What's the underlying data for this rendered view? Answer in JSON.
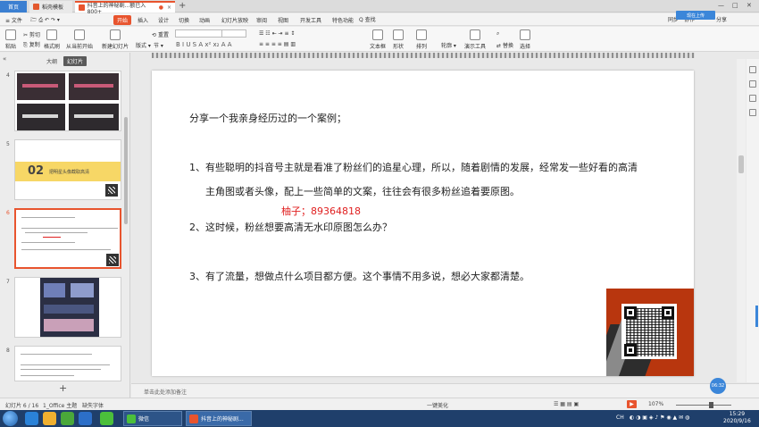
{
  "titlebar": {
    "tab_home": "首页",
    "tab_template": "稻壳模板",
    "tab_doc": "抖音上的神秘剧...额已入800+",
    "new_tab": "+"
  },
  "menubar": {
    "file": "≡ 文件",
    "items": [
      "开始",
      "插入",
      "设计",
      "切换",
      "动画",
      "幻灯片放映",
      "审阅",
      "视图",
      "开发工具",
      "特色功能"
    ],
    "search": "Q 查找",
    "sync": "同步",
    "coop": "协作",
    "share": "分享",
    "sync_upload": "现在上传"
  },
  "ribbon": {
    "paste": "粘贴",
    "cut": "剪切",
    "copy": "复制",
    "format_painter": "格式刷",
    "from_current": "从当前开始",
    "new_slide": "新建幻灯片",
    "layout": "版式",
    "section": "节",
    "reset": "重置",
    "textbox": "文本框",
    "shape": "形状",
    "arrange": "排列",
    "outline": "轮廓",
    "present_tools": "演示工具",
    "replace": "替换",
    "select": "选择",
    "format_glyphs": "B I U S A x² x₂ A A"
  },
  "left_panel": {
    "tab_outline": "大纲",
    "tab_slides": "幻灯片",
    "slide_numbers": [
      "4",
      "5",
      "6",
      "7",
      "8"
    ],
    "thumb5_num": "02",
    "thumb5_title": "把明星头像截取高清",
    "add": "+"
  },
  "slide": {
    "line_intro": "分享一个我亲身经历过的一个案例；",
    "line1a": "1、有些聪明的抖音号主就是看准了粉丝们的追星心理，所以，随着剧情的发展，经常发一些好看的高清",
    "line1b": "主角图或者头像，配上一些简单的文案，往往会有很多粉丝追着要原图。",
    "red_note": "柚子；89364818",
    "line2": "2、这时候，粉丝想要高清无水印原图怎么办？",
    "line3": "3、有了流量，想做点什么项目都方便。这个事情不用多说，想必大家都清楚。"
  },
  "notes": {
    "placeholder": "单击此处添加备注"
  },
  "statusbar": {
    "slide_info": "幻灯片 6 / 16",
    "theme": "1_Office 主题",
    "font_missing": "缺失字体",
    "beautify": "一键美化",
    "zoom": "107%",
    "bubble": "06:32"
  },
  "taskbar": {
    "task_wechat": "微信",
    "task_ppt": "抖音上的神秘剧...",
    "tray_lang": "CH",
    "time": "15:29",
    "date": "2020/9/16"
  },
  "colors": {
    "accent": "#e8542e",
    "taskbar": "#1f3f6b",
    "red_text": "#e02020",
    "qr_bg": "#b8360e"
  }
}
